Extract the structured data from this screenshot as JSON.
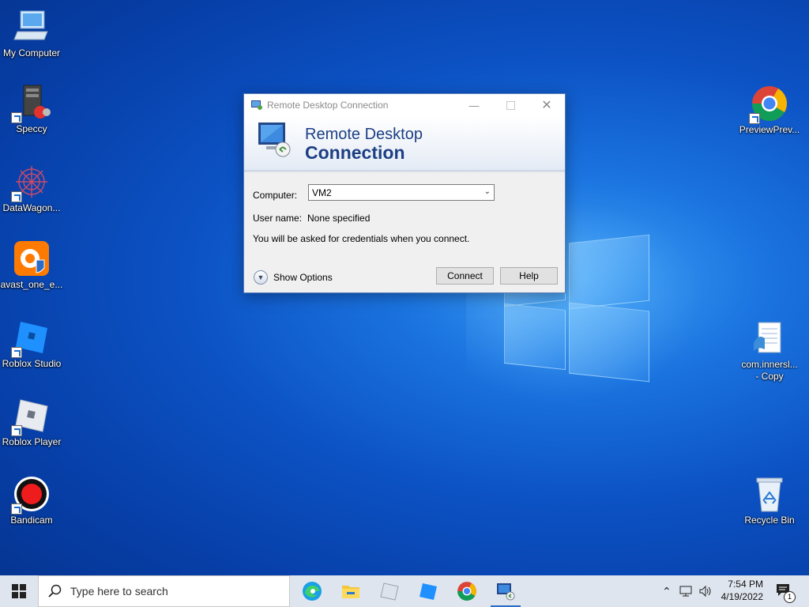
{
  "desktop": {
    "left_icons": [
      {
        "label": "My Computer"
      },
      {
        "label": "Speccy"
      },
      {
        "label": "DataWagon..."
      },
      {
        "label": "avast_one_e..."
      },
      {
        "label": "Roblox Studio"
      },
      {
        "label": "Roblox Player"
      },
      {
        "label": "Bandicam"
      }
    ],
    "right_icons": [
      {
        "label": "PreviewPrev..."
      },
      {
        "label": "com.innersl...",
        "label2": "- Copy"
      },
      {
        "label": "Recycle Bin"
      }
    ]
  },
  "dialog": {
    "title": "Remote Desktop Connection",
    "banner_line1": "Remote Desktop",
    "banner_line2": "Connection",
    "computer_label": "Computer:",
    "computer_value": "VM2",
    "username_label": "User name:",
    "username_value": "None specified",
    "note": "You will be asked for credentials when you connect.",
    "show_options": "Show Options",
    "connect_button": "Connect",
    "help_button": "Help"
  },
  "taskbar": {
    "search_placeholder": "Type here to search",
    "time": "7:54 PM",
    "date": "4/19/2022",
    "notification_count": "1",
    "pinned": [
      "edge-icon",
      "file-explorer-icon",
      "app-icon",
      "roblox-studio-icon",
      "chrome-icon",
      "remote-desktop-icon"
    ]
  },
  "colors": {
    "accent": "#1c3f84",
    "taskbar": "#dfe5ee"
  }
}
